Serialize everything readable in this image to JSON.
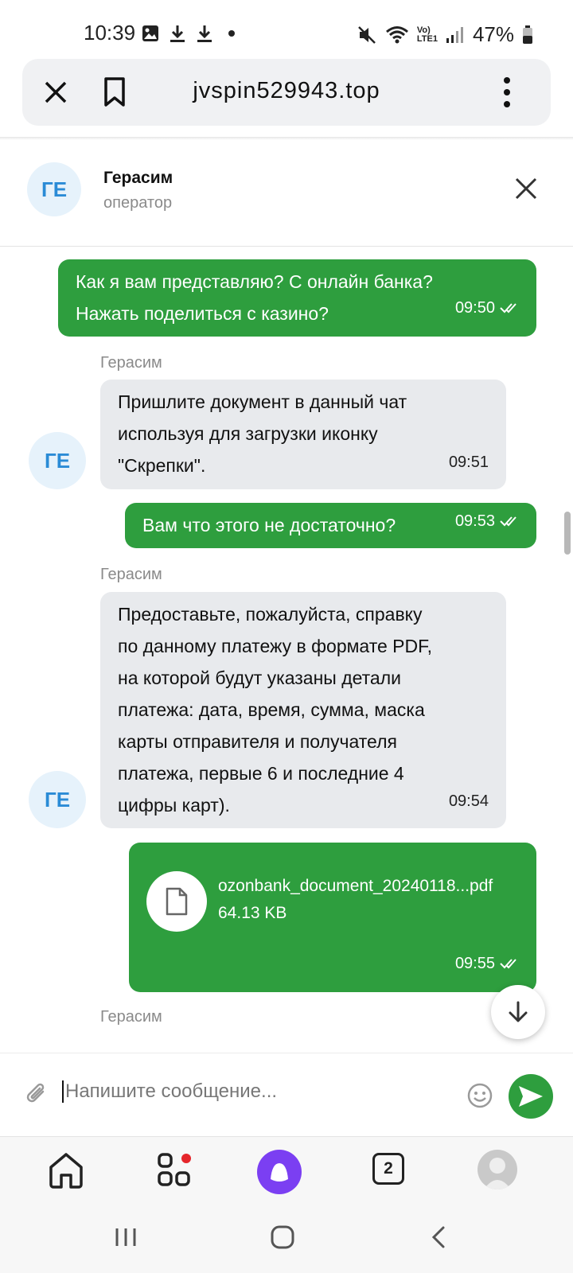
{
  "status_bar": {
    "time": "10:39",
    "network_label_top": "Vo)",
    "network_label_bottom": "LTE1",
    "battery_percent": "47%",
    "icons": [
      "gallery-icon",
      "download-icon",
      "download-icon",
      "dot-icon",
      "mute-icon",
      "wifi-icon",
      "signal-icon",
      "battery-icon"
    ]
  },
  "browser": {
    "url": "jvspin529943.top",
    "close_icon": "close-icon",
    "bookmark_icon": "bookmark-icon",
    "menu_icon": "more-vertical-icon"
  },
  "chat_header": {
    "avatar_initials": "ГЕ",
    "name": "Герасим",
    "role": "оператор"
  },
  "messages": [
    {
      "direction": "out",
      "text_line1": "Как я вам представляю? С онлайн банка?",
      "text_line2": "Нажать поделиться с казино?",
      "time": "09:50"
    },
    {
      "direction": "in",
      "sender": "Герасим",
      "text_line1": "Пришлите документ в данный чат",
      "text_line2": "используя для загрузки иконку",
      "text_line3": "\"Скрепки\".",
      "time": "09:51",
      "avatar": "ГЕ"
    },
    {
      "direction": "out",
      "text": "Вам что этого не достаточно?",
      "time": "09:53"
    },
    {
      "direction": "in",
      "sender": "Герасим",
      "text_line1": "Предоставьте, пожалуйста, справку",
      "text_line2": "по данному платежу в формате PDF,",
      "text_line3": "на которой будут указаны детали",
      "text_line4": "платежа: дата, время, сумма, маска",
      "text_line5": "карты отправителя и получателя",
      "text_line6": "платежа, первые 6 и последние 4",
      "text_line7": "цифры карт).",
      "time": "09:54",
      "avatar": "ГЕ"
    },
    {
      "direction": "out",
      "type": "file",
      "file_name": "ozonbank_document_20240118...pdf",
      "file_size": "64.13 KB",
      "time": "09:55"
    },
    {
      "direction": "in",
      "sender": "Герасим"
    }
  ],
  "composer": {
    "placeholder": "Напишите сообщение...",
    "attach_icon": "paperclip-icon",
    "emoji_icon": "emoji-icon",
    "send_icon": "send-icon"
  },
  "bottom_nav": {
    "tabs_badge": "2",
    "items": [
      "home-icon",
      "apps-icon",
      "alice-icon",
      "tabs-icon",
      "profile-icon"
    ]
  },
  "colors": {
    "outgoing_bubble": "#2e9e3e",
    "incoming_bubble": "#e8eaed",
    "avatar_bg": "#e6f2fb",
    "avatar_text": "#2a8bd6",
    "alice": "#7b3ff2",
    "notification_dot": "#e5262b"
  }
}
